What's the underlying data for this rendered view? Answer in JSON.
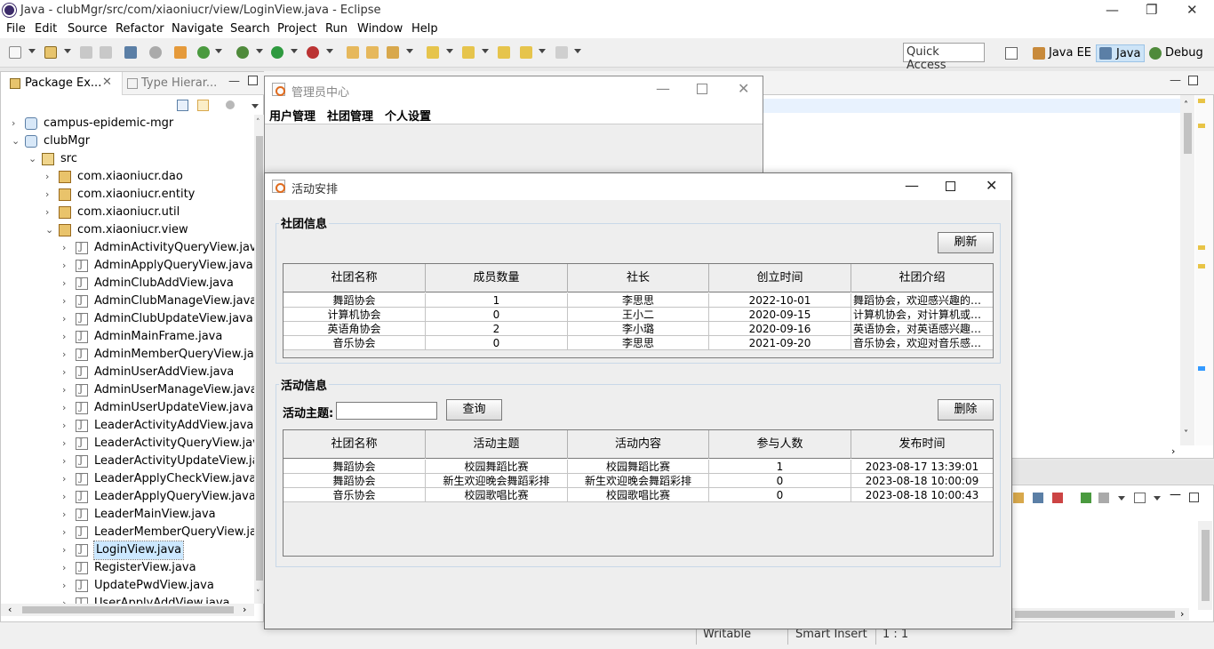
{
  "eclipse": {
    "title": "Java - clubMgr/src/com/xiaoniucr/view/LoginView.java - Eclipse",
    "menu": [
      "File",
      "Edit",
      "Source",
      "Refactor",
      "Navigate",
      "Search",
      "Project",
      "Run",
      "Window",
      "Help"
    ],
    "quick_access": "Quick Access",
    "perspectives": [
      "Java EE",
      "Java",
      "Debug"
    ],
    "status": {
      "writable": "Writable",
      "insert": "Smart Insert",
      "position": "1 : 1"
    }
  },
  "package_explorer": {
    "tab_active": "Package Ex...",
    "tab_inactive": "Type Hierar...",
    "tree": [
      {
        "label": "campus-epidemic-mgr",
        "kind": "proj",
        "depth": 0,
        "arrow": "›"
      },
      {
        "label": "clubMgr",
        "kind": "proj",
        "depth": 0,
        "arrow": "⌄"
      },
      {
        "label": "src",
        "kind": "src",
        "depth": 1,
        "arrow": "⌄"
      },
      {
        "label": "com.xiaoniucr.dao",
        "kind": "pkg",
        "depth": 2,
        "arrow": "›"
      },
      {
        "label": "com.xiaoniucr.entity",
        "kind": "pkg",
        "depth": 2,
        "arrow": "›"
      },
      {
        "label": "com.xiaoniucr.util",
        "kind": "pkg",
        "depth": 2,
        "arrow": "›"
      },
      {
        "label": "com.xiaoniucr.view",
        "kind": "pkg",
        "depth": 2,
        "arrow": "⌄"
      },
      {
        "label": "AdminActivityQueryView.java",
        "kind": "java",
        "depth": 3,
        "arrow": "›"
      },
      {
        "label": "AdminApplyQueryView.java",
        "kind": "java",
        "depth": 3,
        "arrow": "›"
      },
      {
        "label": "AdminClubAddView.java",
        "kind": "java",
        "depth": 3,
        "arrow": "›"
      },
      {
        "label": "AdminClubManageView.java",
        "kind": "java",
        "depth": 3,
        "arrow": "›"
      },
      {
        "label": "AdminClubUpdateView.java",
        "kind": "java",
        "depth": 3,
        "arrow": "›"
      },
      {
        "label": "AdminMainFrame.java",
        "kind": "java",
        "depth": 3,
        "arrow": "›"
      },
      {
        "label": "AdminMemberQueryView.java",
        "kind": "java",
        "depth": 3,
        "arrow": "›"
      },
      {
        "label": "AdminUserAddView.java",
        "kind": "java",
        "depth": 3,
        "arrow": "›"
      },
      {
        "label": "AdminUserManageView.java",
        "kind": "java",
        "depth": 3,
        "arrow": "›"
      },
      {
        "label": "AdminUserUpdateView.java",
        "kind": "java",
        "depth": 3,
        "arrow": "›"
      },
      {
        "label": "LeaderActivityAddView.java",
        "kind": "java",
        "depth": 3,
        "arrow": "›"
      },
      {
        "label": "LeaderActivityQueryView.java",
        "kind": "java",
        "depth": 3,
        "arrow": "›"
      },
      {
        "label": "LeaderActivityUpdateView.java",
        "kind": "java",
        "depth": 3,
        "arrow": "›"
      },
      {
        "label": "LeaderApplyCheckView.java",
        "kind": "java",
        "depth": 3,
        "arrow": "›"
      },
      {
        "label": "LeaderApplyQueryView.java",
        "kind": "java",
        "depth": 3,
        "arrow": "›"
      },
      {
        "label": "LeaderMainView.java",
        "kind": "java",
        "depth": 3,
        "arrow": "›"
      },
      {
        "label": "LeaderMemberQueryView.java",
        "kind": "java",
        "depth": 3,
        "arrow": "›"
      },
      {
        "label": "LoginView.java",
        "kind": "java",
        "depth": 3,
        "arrow": "›",
        "selected": true
      },
      {
        "label": "RegisterView.java",
        "kind": "java",
        "depth": 3,
        "arrow": "›"
      },
      {
        "label": "UpdatePwdView.java",
        "kind": "java",
        "depth": 3,
        "arrow": "›"
      },
      {
        "label": "UserApplyAddView.java",
        "kind": "java",
        "depth": 3,
        "arrow": "›"
      }
    ]
  },
  "admin_window": {
    "title": "管理员中心",
    "menu": [
      "用户管理",
      "社团管理",
      "个人设置"
    ]
  },
  "activity_dialog": {
    "title": "活动安排",
    "club_group": {
      "title": "社团信息",
      "refresh_label": "刷新",
      "columns": [
        "社团名称",
        "成员数量",
        "社长",
        "创立时间",
        "社团介绍"
      ],
      "rows": [
        [
          "舞蹈协会",
          "1",
          "李思思",
          "2022-10-01",
          "舞蹈协会，欢迎感兴趣的加..."
        ],
        [
          "计算机协会",
          "0",
          "王小二",
          "2020-09-15",
          "计算机协会，对计算机或者..."
        ],
        [
          "英语角协会",
          "2",
          "李小璐",
          "2020-09-16",
          "英语协会，对英语感兴趣的..."
        ],
        [
          "音乐协会",
          "0",
          "李思思",
          "2021-09-20",
          "音乐协会，欢迎对音乐感兴..."
        ]
      ]
    },
    "activity_group": {
      "title": "活动信息",
      "topic_label": "活动主题:",
      "topic_value": "",
      "query_label": "查询",
      "delete_label": "删除",
      "columns": [
        "社团名称",
        "活动主题",
        "活动内容",
        "参与人数",
        "发布时间"
      ],
      "rows": [
        [
          "舞蹈协会",
          "校园舞蹈比赛",
          "校园舞蹈比赛",
          "1",
          "2023-08-17 13:39:01"
        ],
        [
          "舞蹈协会",
          "新生欢迎晚会舞蹈彩排",
          "新生欢迎晚会舞蹈彩排",
          "0",
          "2023-08-18 10:00:09"
        ],
        [
          "音乐协会",
          "校园歌唱比赛",
          "校园歌唱比赛",
          "0",
          "2023-08-18 10:00:43"
        ]
      ]
    }
  },
  "colors": {
    "selection": "#cce8ff",
    "accent": "#3399ff"
  }
}
